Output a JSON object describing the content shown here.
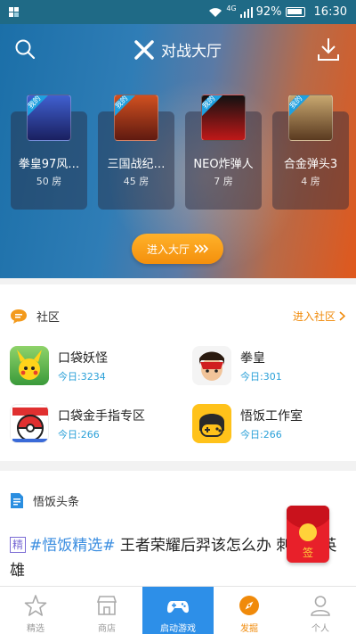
{
  "status_bar": {
    "signal": "4G",
    "battery": "92%",
    "time": "16:30"
  },
  "header": {
    "title": "对战大厅"
  },
  "games": [
    {
      "name": "拳皇97风…",
      "rooms": "50 房",
      "tag": "我的",
      "thumb_color": "#2a3a88"
    },
    {
      "name": "三国战纪…",
      "rooms": "45 房",
      "tag": "我的",
      "thumb_color": "#b53a1a"
    },
    {
      "name": "NEO炸弹人",
      "rooms": "7 房",
      "tag": "我的",
      "thumb_color": "#c01818"
    },
    {
      "name": "合金弹头3",
      "rooms": "4 房",
      "tag": "我的",
      "thumb_color": "#7a5a3a"
    }
  ],
  "enter_hall_label": "进入大厅",
  "community": {
    "title": "社区",
    "enter_label": "进入社区",
    "boards": [
      {
        "name": "口袋妖怪",
        "today": "今日:3234"
      },
      {
        "name": "拳皇",
        "today": "今日:301"
      },
      {
        "name": "口袋金手指专区",
        "today": "今日:266"
      },
      {
        "name": "悟饭工作室",
        "today": "今日:266"
      }
    ]
  },
  "headline": {
    "title": "悟饭头条",
    "tag": "精",
    "hashtag": "#悟饭精选#",
    "text": " 王者荣耀后羿该怎么办 刺客类英雄"
  },
  "red_packet_label": "签",
  "tabs": [
    {
      "label": "精选"
    },
    {
      "label": "商店"
    },
    {
      "label": "启动游戏"
    },
    {
      "label": "发掘"
    },
    {
      "label": "个人"
    }
  ]
}
